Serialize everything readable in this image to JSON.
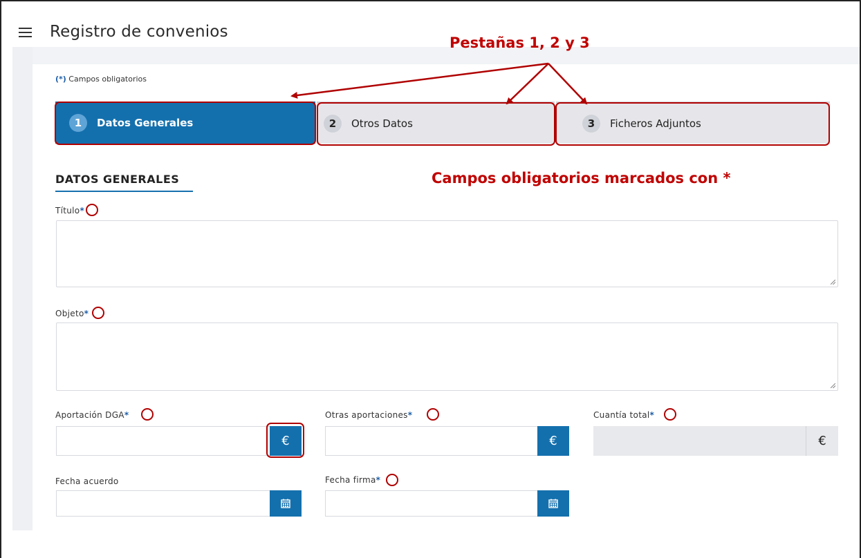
{
  "app": {
    "title": "Registro de convenios"
  },
  "form": {
    "required_note_ast": "(*)",
    "required_note_text": " Campos obligatorios",
    "tabs": [
      {
        "num": "1",
        "label": "Datos Generales",
        "active": true
      },
      {
        "num": "2",
        "label": "Otros Datos",
        "active": false
      },
      {
        "num": "3",
        "label": "Ficheros Adjuntos",
        "active": false
      }
    ],
    "section_title": "DATOS GENERALES",
    "fields": {
      "titulo": {
        "label": "Título",
        "value": ""
      },
      "objeto": {
        "label": "Objeto",
        "value": ""
      },
      "aportacion_dga": {
        "label": "Aportación DGA",
        "value": "",
        "addon": "€"
      },
      "otras_aportaciones": {
        "label": "Otras aportaciones",
        "value": "",
        "addon": "€"
      },
      "cuantia_total": {
        "label": "Cuantía total",
        "value": "",
        "addon": "€"
      },
      "fecha_acuerdo": {
        "label": "Fecha acuerdo",
        "value": ""
      },
      "fecha_firma": {
        "label": "Fecha firma",
        "value": ""
      }
    },
    "required_marker": "*"
  },
  "annotations": {
    "tabs_callout": "Pestañas 1, 2 y 3",
    "required_callout": "Campos obligatorios marcados con *"
  },
  "colors": {
    "primary": "#1470ad",
    "annotation": "#c00000",
    "annotation_border": "#b00000",
    "tab_inactive": "#e6e6ea"
  },
  "icons": {
    "menu": "hamburger-menu-icon",
    "currency": "euro-icon",
    "calendar": "calendar-icon"
  }
}
